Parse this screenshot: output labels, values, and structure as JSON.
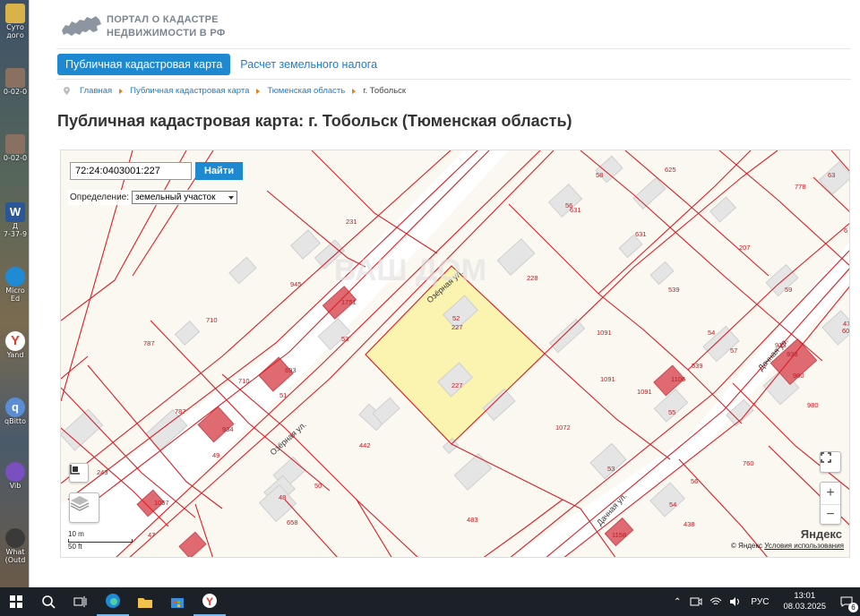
{
  "desktop": {
    "icons": [
      {
        "label": "Суто",
        "sub": "дого",
        "color": "#d9b34a"
      },
      {
        "label": "0-02-0",
        "sub": "",
        "color": "#a07a5a"
      },
      {
        "label": "0-02-0",
        "sub": "",
        "color": "#a07a5a"
      },
      {
        "label": "Д",
        "sub": "7-37-9",
        "color": "#2b5797"
      },
      {
        "label": "Micro",
        "sub": "Ed",
        "color": "#1f8ad6"
      },
      {
        "label": "Yand",
        "sub": "",
        "color": "#e23b2b"
      },
      {
        "label": "qBitto",
        "sub": "",
        "color": "#5b8dd6"
      },
      {
        "label": "Vib",
        "sub": "",
        "color": "#7a4fbf"
      },
      {
        "label": "What",
        "sub": "(Outd",
        "color": "#3a3a3a"
      }
    ]
  },
  "header": {
    "logo_line1": "ПОРТАЛ О КАДАСТРЕ",
    "logo_line2": "НЕДВИЖИМОСТИ В РФ"
  },
  "tabs": {
    "active": "Публичная кадастровая карта",
    "second": "Расчет земельного налога"
  },
  "breadcrumb": {
    "items": [
      "Главная",
      "Публичная кадастровая карта",
      "Тюменская область"
    ],
    "current": "г. Тобольск"
  },
  "page_title": "Публичная кадастровая карта: г. Тобольск (Тюменская область)",
  "map": {
    "search_value": "72:24:0403001:227",
    "search_button": "Найти",
    "definition_label": "Определение:",
    "definition_value": "земельный участок",
    "scale_m": "10 m",
    "scale_ft": "50 ft",
    "attribution": "© Яндекс",
    "terms_link": "Условия использования",
    "yandex_logo": "Яндекс",
    "watermark": "ВАШ ДОМ",
    "zoom_in": "+",
    "zoom_out": "−",
    "streets": [
      "Озёрная ул.",
      "Озёрная ул.",
      "Дачная ул."
    ],
    "parcel_labels": [
      "231",
      "945",
      "710",
      "710",
      "787",
      "787",
      "1751",
      "693",
      "934",
      "442",
      "243",
      "1057",
      "658",
      "483",
      "1072",
      "1091",
      "1091",
      "1091",
      "539",
      "539",
      "631",
      "631",
      "625",
      "778",
      "207",
      "63",
      "6",
      "59",
      "47",
      "60",
      "57",
      "933",
      "980",
      "933",
      "980",
      "1106",
      "55",
      "760",
      "56",
      "54",
      "438",
      "1158",
      "53",
      "58",
      "56",
      "54",
      "228",
      "52",
      "227",
      "227",
      "53",
      "51",
      "49",
      "48",
      "50",
      "47"
    ],
    "highlight_color": "#fbf3a8",
    "border_color": "#d81f26",
    "building_color": "#e5e5e5",
    "registered_building_color": "#e06a72"
  },
  "taskbar": {
    "lang": "РУС",
    "time": "13:01",
    "date": "08.03.2025",
    "notifications": "6"
  }
}
